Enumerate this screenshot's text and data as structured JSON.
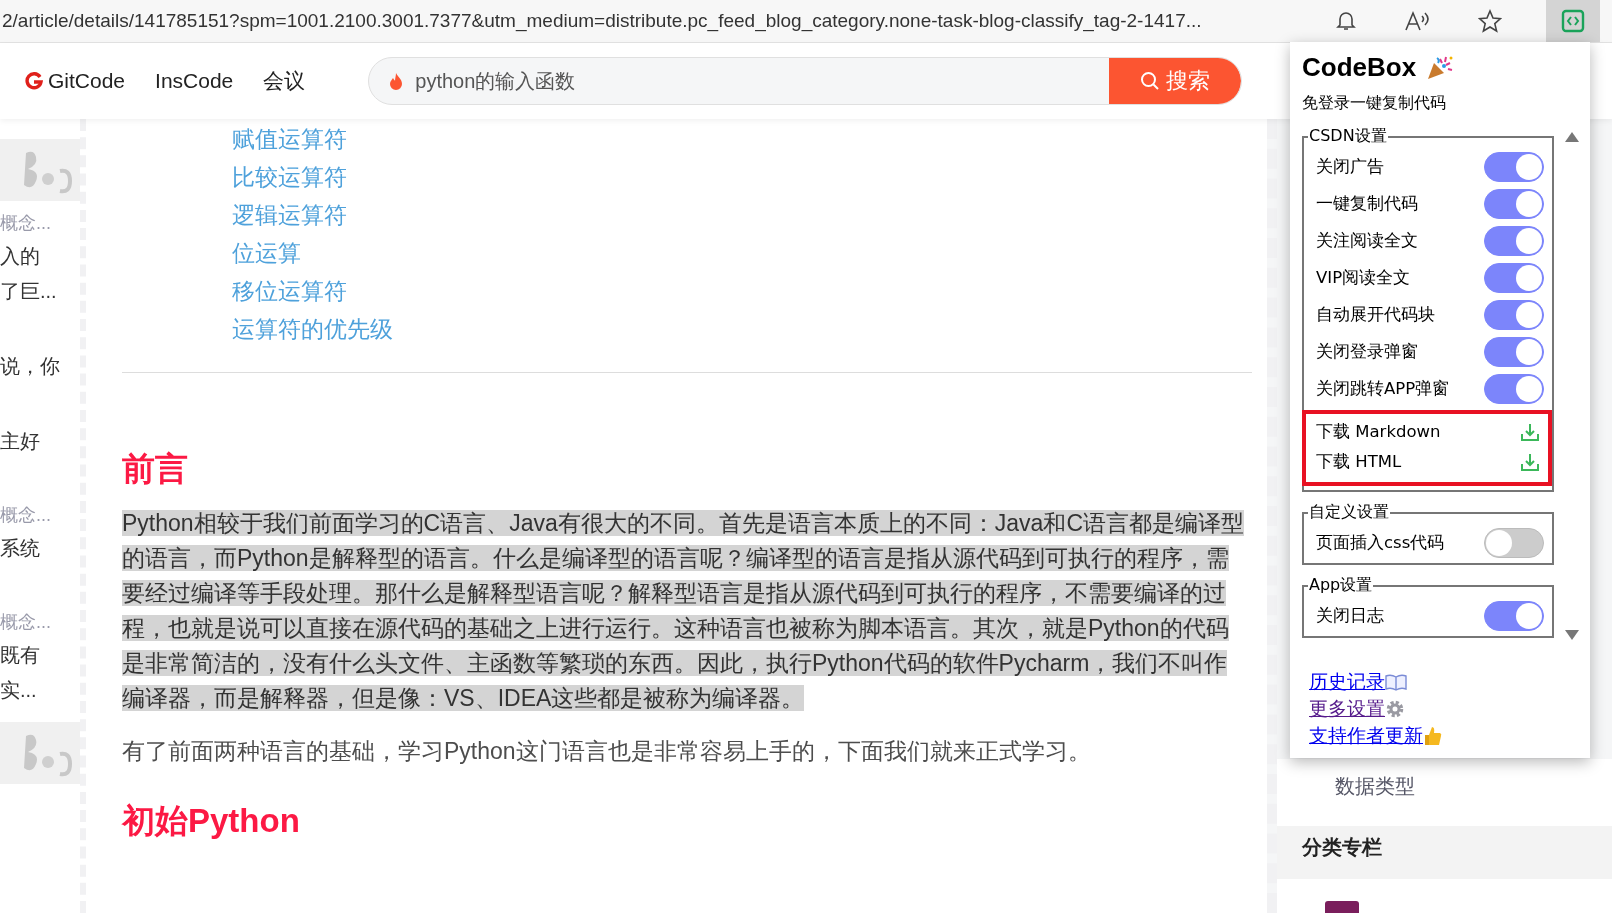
{
  "browser": {
    "url": "2/article/details/141785151?spm=1001.2100.3001.7377&utm_medium=distribute.pc_feed_blog_category.none-task-blog-classify_tag-2-1417..."
  },
  "site_nav": {
    "links": [
      "GitCode",
      "InsCode",
      "会议"
    ],
    "search": {
      "value": "python的输入函数",
      "button": "搜索"
    }
  },
  "left_sidebar": {
    "cards": [
      {
        "kind": "picture"
      },
      {
        "kind": "text",
        "lines": [
          {
            "kind": "meta",
            "text": "概念..."
          },
          {
            "kind": "body",
            "text": "入的"
          },
          {
            "kind": "body",
            "text": "了巨..."
          }
        ]
      },
      {
        "kind": "text",
        "lines": [
          {
            "kind": "body",
            "text": "说，你"
          }
        ]
      },
      {
        "kind": "text",
        "lines": [
          {
            "kind": "body",
            "text": "主好"
          }
        ]
      },
      {
        "kind": "text",
        "lines": [
          {
            "kind": "meta",
            "text": "概念..."
          },
          {
            "kind": "body",
            "text": "系统"
          }
        ]
      },
      {
        "kind": "text",
        "lines": [
          {
            "kind": "meta",
            "text": "概念..."
          },
          {
            "kind": "body",
            "text": "既有"
          },
          {
            "kind": "body",
            "text": "实..."
          }
        ]
      },
      {
        "kind": "picture"
      }
    ]
  },
  "article": {
    "toc": [
      "赋值运算符",
      "比较运算符",
      "逻辑运算符",
      "位运算",
      "移位运算符",
      "运算符的优先级"
    ],
    "sections": [
      {
        "heading": "前言",
        "paragraphs": [
          {
            "text": "Python相较于我们前面学习的C语言、Java有很大的不同。首先是语言本质上的不同：Java和C语言都是编译型的语言，而Python是解释型的语言。什么是编译型的语言呢？编译型的语言是指从源代码到可执行的程序，需要经过编译等手段处理。那什么是解释型语言呢？解释型语言是指从源代码到可执行的程序，不需要编译的过程，也就是说可以直接在源代码的基础之上进行运行。这种语言也被称为脚本语言。其次，就是Python的代码是非常简洁的，没有什么头文件、主函数等繁琐的东西。因此，执行Python代码的软件Pycharm，我们不叫作编译器，而是解释器，但是像：VS、IDEA这些都是被称为编译器。",
            "selected": true
          },
          {
            "text": "有了前面两种语言的基础，学习Python这门语言也是非常容易上手的，下面我们就来正式学习。",
            "selected": false
          }
        ]
      },
      {
        "heading": "初始Python"
      }
    ]
  },
  "right_sidebar": {
    "items": [
      "数据类型"
    ],
    "section_title": "分类专栏"
  },
  "extension_popup": {
    "title": "CodeBox",
    "subtitle": "免登录一键复制代码",
    "groups": [
      {
        "legend": "CSDN设置",
        "options": [
          {
            "label": "关闭广告",
            "on": true
          },
          {
            "label": "一键复制代码",
            "on": true
          },
          {
            "label": "关注阅读全文",
            "on": true
          },
          {
            "label": "VIP阅读全文",
            "on": true
          },
          {
            "label": "自动展开代码块",
            "on": true
          },
          {
            "label": "关闭登录弹窗",
            "on": true
          },
          {
            "label": "关闭跳转APP弹窗",
            "on": true
          }
        ],
        "downloads": [
          "下载 Markdown",
          "下载 HTML"
        ]
      },
      {
        "legend": "自定义设置",
        "options": [
          {
            "label": "页面插入css代码",
            "on": false
          }
        ]
      },
      {
        "legend": "App设置",
        "options": [
          {
            "label": "关闭日志",
            "on": true
          }
        ]
      }
    ],
    "links": [
      {
        "text": "历史记录",
        "kind": "book",
        "visited": false
      },
      {
        "text": "更多设置",
        "kind": "gear",
        "visited": true
      },
      {
        "text": "支持作者更新",
        "kind": "thumb",
        "visited": false
      }
    ]
  }
}
